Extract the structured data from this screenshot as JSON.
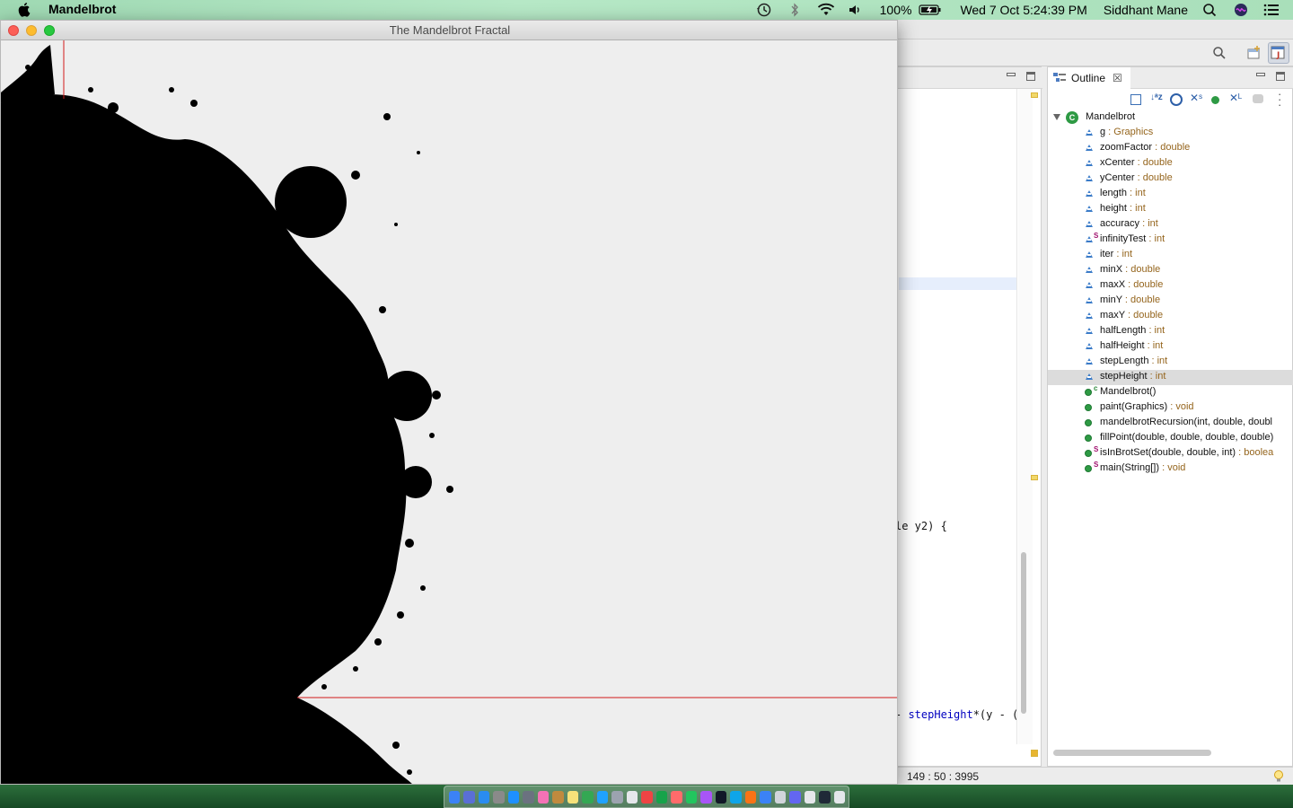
{
  "menubar": {
    "app_name": "Mandelbrot",
    "battery": "100%",
    "datetime": "Wed 7 Oct  5:24:39 PM",
    "user": "Siddhant Mane"
  },
  "mandelbrot_window": {
    "title": "The Mandelbrot Fractal"
  },
  "eclipse": {
    "editor": {
      "code_lines": [
        {
          "pre": "le y2) {",
          "field": "",
          "post": ""
        },
        {
          "pre": "- ",
          "field": "stepHeight",
          "post": "*(y - ("
        }
      ]
    },
    "outline": {
      "tab_label": "Outline",
      "root": "Mandelbrot",
      "items": [
        {
          "name": "g",
          "type": " : Graphics",
          "kind": "field",
          "mod": ""
        },
        {
          "name": "zoomFactor",
          "type": " : double",
          "kind": "field",
          "mod": ""
        },
        {
          "name": "xCenter",
          "type": " : double",
          "kind": "field",
          "mod": ""
        },
        {
          "name": "yCenter",
          "type": " : double",
          "kind": "field",
          "mod": ""
        },
        {
          "name": "length",
          "type": " : int",
          "kind": "field",
          "mod": ""
        },
        {
          "name": "height",
          "type": " : int",
          "kind": "field",
          "mod": ""
        },
        {
          "name": "accuracy",
          "type": " : int",
          "kind": "field",
          "mod": ""
        },
        {
          "name": "infinityTest",
          "type": " : int",
          "kind": "field",
          "mod": "S"
        },
        {
          "name": "iter",
          "type": " : int",
          "kind": "field",
          "mod": ""
        },
        {
          "name": "minX",
          "type": " : double",
          "kind": "field",
          "mod": ""
        },
        {
          "name": "maxX",
          "type": " : double",
          "kind": "field",
          "mod": ""
        },
        {
          "name": "minY",
          "type": " : double",
          "kind": "field",
          "mod": ""
        },
        {
          "name": "maxY",
          "type": " : double",
          "kind": "field",
          "mod": ""
        },
        {
          "name": "halfLength",
          "type": " : int",
          "kind": "field",
          "mod": ""
        },
        {
          "name": "halfHeight",
          "type": " : int",
          "kind": "field",
          "mod": ""
        },
        {
          "name": "stepLength",
          "type": " : int",
          "kind": "field",
          "mod": ""
        },
        {
          "name": "stepHeight",
          "type": " : int",
          "kind": "field",
          "mod": "",
          "selected": true
        },
        {
          "name": "Mandelbrot()",
          "type": "",
          "kind": "method",
          "mod": "c"
        },
        {
          "name": "paint(Graphics)",
          "type": " : void",
          "kind": "method",
          "mod": ""
        },
        {
          "name": "mandelbrotRecursion(int, double, doubl",
          "type": "",
          "kind": "method",
          "mod": ""
        },
        {
          "name": "fillPoint(double, double, double, double)",
          "type": "",
          "kind": "method",
          "mod": ""
        },
        {
          "name": "isInBrotSet(double, double, int)",
          "type": " : boolea",
          "kind": "method",
          "mod": "S"
        },
        {
          "name": "main(String[])",
          "type": " : void",
          "kind": "method",
          "mod": "S"
        }
      ]
    },
    "status": {
      "position": "149 : 50 : 3995"
    }
  },
  "colors": {
    "fractal_fill": "#000000",
    "fractal_bg": "#eeeeee",
    "crosshair": "#d11a1a",
    "type_text": "#95651d",
    "static_marker": "#a0106e"
  },
  "dock": {
    "icons": [
      "#3b82f6",
      "#5a6fd6",
      "#2a8cf0",
      "#8a8a8a",
      "#1e90ff",
      "#6b7280",
      "#f472b6",
      "#c08a3e",
      "#f6e27a",
      "#34a853",
      "#1fa2ff",
      "#9ca3af",
      "#e5e7eb",
      "#ef4444",
      "#16a34a",
      "#ff6b6b",
      "#22c55e",
      "#a855f7",
      "#111827",
      "#0ea5e9",
      "#f97316",
      "#3b82f6",
      "#d1d5db",
      "#6366f1",
      "#e5e7eb",
      "#1f2937",
      "#e5e7eb"
    ]
  }
}
